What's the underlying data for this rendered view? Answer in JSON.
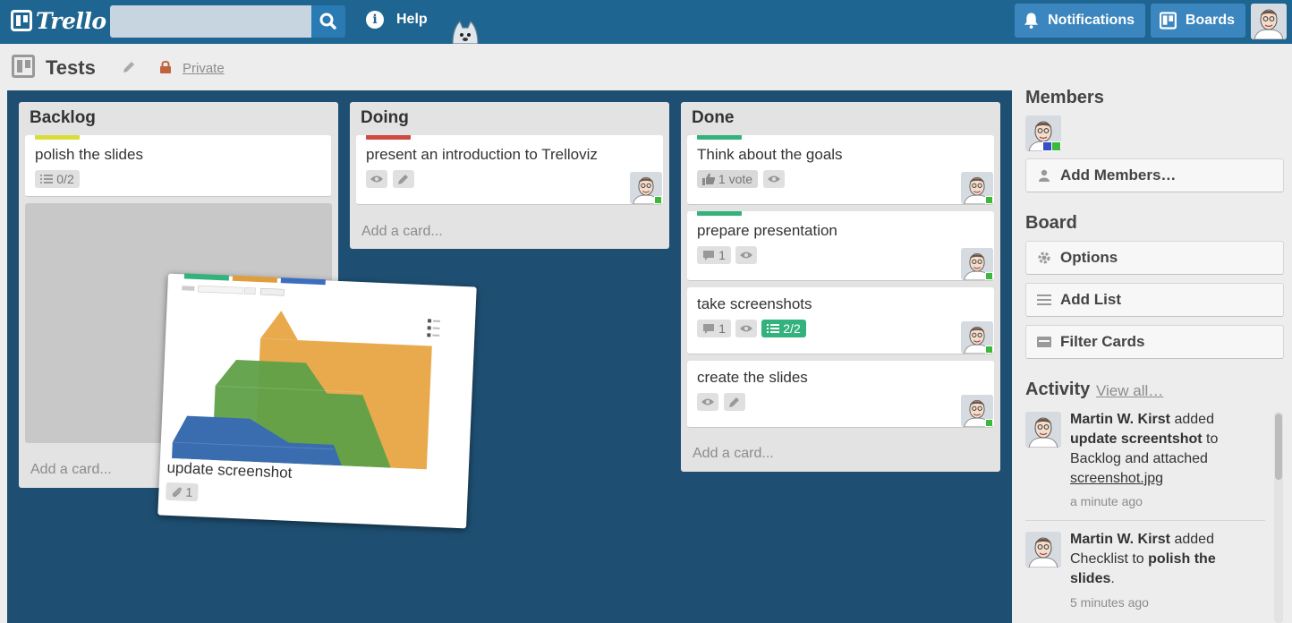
{
  "header": {
    "logo_text": "Trello",
    "search": {
      "value": "",
      "placeholder": ""
    },
    "help_label": "Help",
    "notifications_label": "Notifications",
    "boards_label": "Boards"
  },
  "board": {
    "title": "Tests",
    "visibility": "Private"
  },
  "lists": [
    {
      "title": "Backlog",
      "add_card": "Add a card...",
      "cards": [
        {
          "title": "polish the slides",
          "label_color": "#d9dd3a",
          "checklist": "0/2"
        }
      ]
    },
    {
      "title": "Doing",
      "add_card": "Add a card...",
      "cards": [
        {
          "title": "present an introduction to Trelloviz",
          "label_color": "#cf4a3f"
        }
      ]
    },
    {
      "title": "Done",
      "add_card": "Add a card...",
      "cards": [
        {
          "title": "Think about the goals",
          "label_color": "#34b27d",
          "votes": "1 vote"
        },
        {
          "title": "prepare presentation",
          "label_color": "#34b27d",
          "comments": "1"
        },
        {
          "title": "take screenshots",
          "comments": "1",
          "checklist": "2/2"
        },
        {
          "title": "create the slides"
        }
      ]
    }
  ],
  "dragged_card": {
    "title": "update screenshot",
    "attachments": "1",
    "label_colors": [
      "#34b27d",
      "#e09d3c",
      "#3b6ec1"
    ]
  },
  "sidebar": {
    "members_heading": "Members",
    "add_members_label": "Add Members…",
    "board_heading": "Board",
    "options_label": "Options",
    "add_list_label": "Add List",
    "filter_cards_label": "Filter Cards",
    "activity_heading": "Activity",
    "view_all_label": "View all…",
    "activity": [
      {
        "user": "Martin W. Kirst",
        "verb": "added",
        "card": "update screentshot",
        "mid1": "to",
        "list": "Backlog and attached",
        "attachment": "screenshot.jpg",
        "time": "a minute ago"
      },
      {
        "user": "Martin W. Kirst",
        "verb": "added",
        "object": "Checklist to",
        "card": "polish the slides",
        "end": ".",
        "time": "5 minutes ago"
      }
    ]
  },
  "colors": {
    "header_bg": "#1f6591",
    "board_bg": "#1e4f72",
    "header_button": "#3b86bf",
    "badge_complete": "#34b27d"
  }
}
